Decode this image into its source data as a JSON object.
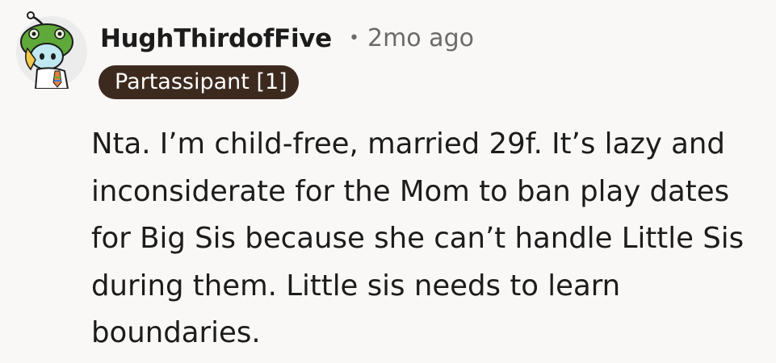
{
  "comment": {
    "author": "HughThirdofFive",
    "separator": "•",
    "timestamp": "2mo ago",
    "flair": "Partassipant [1]",
    "avatar_icon": "snoo-avatar-green-frog-hat",
    "body": "Nta. I’m child-free, married 29f. It’s lazy and inconsiderate for the Mom to ban play dates for Big Sis because she can’t handle Little Sis during them. Little sis needs to learn boundaries."
  },
  "colors": {
    "background": "#faf8f7",
    "flair_background": "#3d2a1e",
    "flair_text": "#ffffff",
    "username": "#1c1c1c",
    "meta": "#6b6b6b"
  }
}
